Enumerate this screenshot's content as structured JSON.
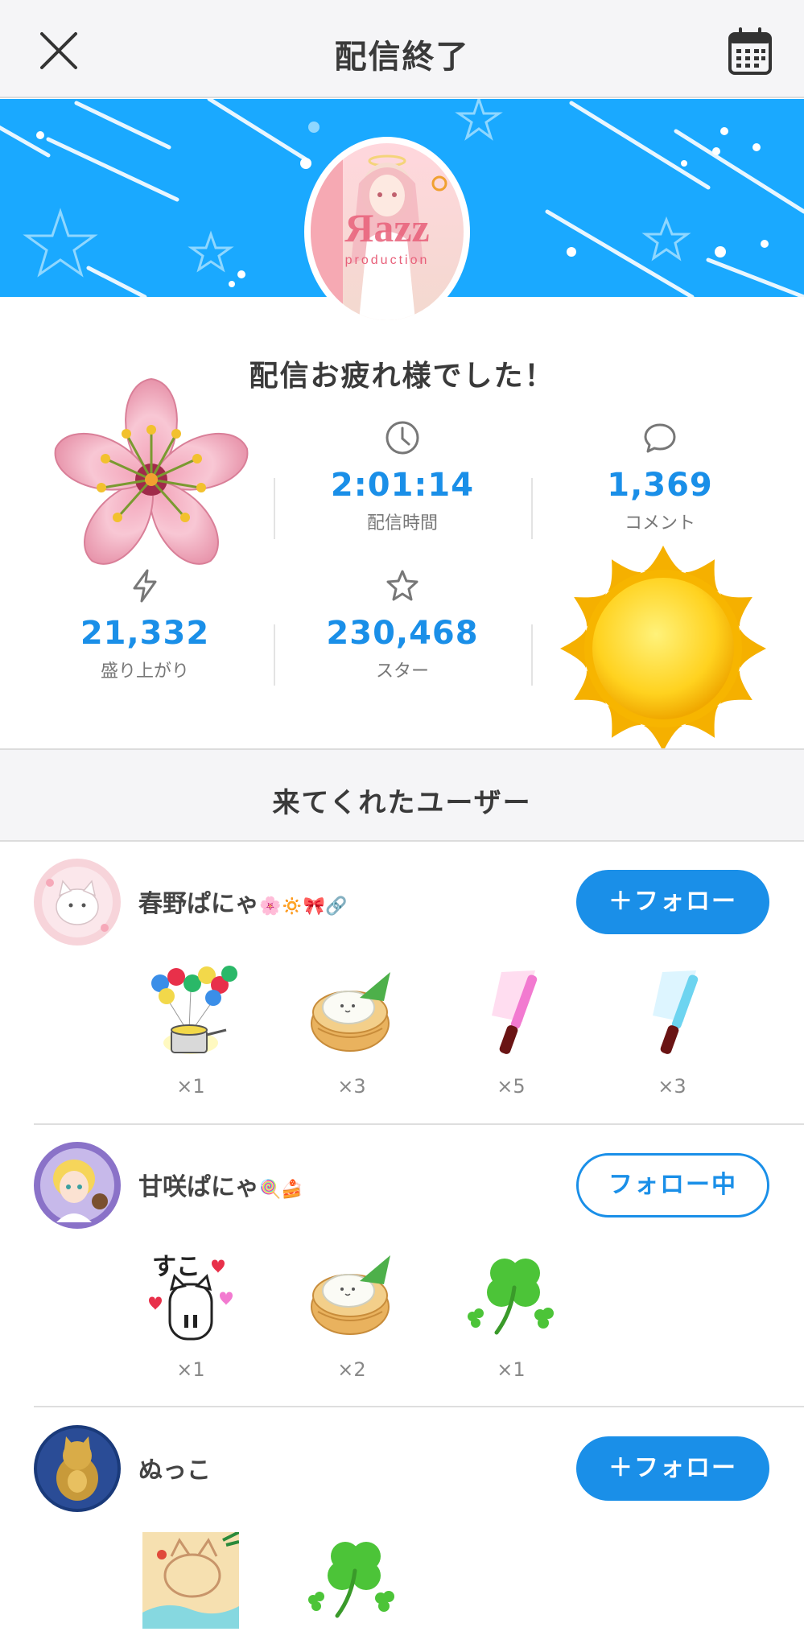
{
  "header": {
    "title": "配信終了",
    "close_icon": "close-icon",
    "calendar_icon": "calendar-icon"
  },
  "banner": {
    "background_color": "#1aa9ff",
    "avatar_text": "Яazz",
    "avatar_subtext": "production"
  },
  "summary": {
    "thanks": "配信お疲れ様でした！",
    "stats": [
      {
        "icon": "clock-icon",
        "value": "2:01:14",
        "label": "配信時間"
      },
      {
        "icon": "comment-icon",
        "value": "1,369",
        "label": "コメント"
      },
      {
        "icon": "lightning-icon",
        "value": "21,332",
        "label": "盛り上がり"
      },
      {
        "icon": "star-icon",
        "value": "230,468",
        "label": "スター"
      }
    ]
  },
  "visitors": {
    "title": "来てくれたユーザー",
    "users": [
      {
        "name": "春野ぱにゃ",
        "name_emoji": "🌸🔅🎀🔗",
        "follow_label": "＋フォロー",
        "follow_state": "not-following",
        "gifts": [
          {
            "icon": "balloon-pot-gift-icon",
            "count": "×1"
          },
          {
            "icon": "steamed-bun-gift-icon",
            "count": "×3"
          },
          {
            "icon": "pink-penlight-gift-icon",
            "count": "×5"
          },
          {
            "icon": "blue-penlight-gift-icon",
            "count": "×3"
          }
        ]
      },
      {
        "name": "甘咲ぱにゃ",
        "name_emoji": "🍭🍰",
        "follow_label": "フォロー中",
        "follow_state": "following",
        "gifts": [
          {
            "icon": "suki-cat-gift-icon",
            "count": "×1"
          },
          {
            "icon": "steamed-bun-gift-icon",
            "count": "×2"
          },
          {
            "icon": "clover-gift-icon",
            "count": "×1"
          }
        ]
      },
      {
        "name": "ぬっこ",
        "name_emoji": "",
        "follow_label": "＋フォロー",
        "follow_state": "not-following",
        "gifts": [
          {
            "icon": "beach-cat-gift-icon",
            "count": ""
          },
          {
            "icon": "clover-gift-icon",
            "count": ""
          }
        ]
      }
    ]
  },
  "colors": {
    "accent": "#1a8fe8",
    "banner": "#1aa9ff",
    "header_bg": "#f5f5f7"
  }
}
